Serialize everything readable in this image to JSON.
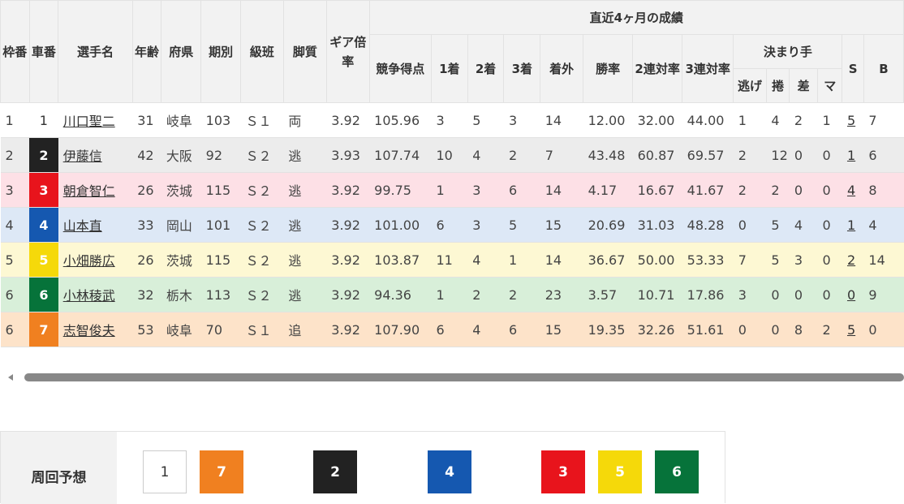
{
  "colors": {
    "car_1": "#ffffff",
    "car_2": "#222222",
    "car_3": "#e8141c",
    "car_4": "#1558b0",
    "car_5": "#f5d90a",
    "car_6": "#06733a",
    "car_7": "#f08020"
  },
  "table": {
    "headers": {
      "waku": "枠番",
      "sha": "車番",
      "name": "選手名",
      "age": "年齢",
      "pref": "府県",
      "term": "期別",
      "class": "級班",
      "style": "脚質",
      "gear": "ギア倍率",
      "recent": "直近4ヶ月の成績",
      "score": "競争得点",
      "first": "1着",
      "second": "2着",
      "third": "3着",
      "out": "着外",
      "win_rate": "勝率",
      "top2": "2連対率",
      "top3": "3連対率",
      "kimarite": "決まり手",
      "nige": "逃げ",
      "makuri": "捲",
      "sashi": "差",
      "ma": "マ",
      "s": "S",
      "b": "B"
    },
    "rows": [
      {
        "waku": "1",
        "car": "1",
        "name": "川口聖二",
        "age": "31",
        "pref": "岐阜",
        "term": "103",
        "class": "Ｓ１",
        "style": "両",
        "gear": "3.92",
        "score": "105.96",
        "first": "3",
        "second": "5",
        "third": "3",
        "out": "14",
        "win_rate": "12.00",
        "top2": "32.00",
        "top3": "44.00",
        "nige": "1",
        "makuri": "4",
        "sashi": "2",
        "ma": "1",
        "s": "5",
        "b": "7"
      },
      {
        "waku": "2",
        "car": "2",
        "name": "伊藤信",
        "age": "42",
        "pref": "大阪",
        "term": "92",
        "class": "Ｓ２",
        "style": "逃",
        "gear": "3.93",
        "score": "107.74",
        "first": "10",
        "second": "4",
        "third": "2",
        "out": "7",
        "win_rate": "43.48",
        "top2": "60.87",
        "top3": "69.57",
        "nige": "2",
        "makuri": "12",
        "sashi": "0",
        "ma": "0",
        "s": "1",
        "b": "6"
      },
      {
        "waku": "3",
        "car": "3",
        "name": "朝倉智仁",
        "age": "26",
        "pref": "茨城",
        "term": "115",
        "class": "Ｓ２",
        "style": "逃",
        "gear": "3.92",
        "score": "99.75",
        "first": "1",
        "second": "3",
        "third": "6",
        "out": "14",
        "win_rate": "4.17",
        "top2": "16.67",
        "top3": "41.67",
        "nige": "2",
        "makuri": "2",
        "sashi": "0",
        "ma": "0",
        "s": "4",
        "b": "8"
      },
      {
        "waku": "4",
        "car": "4",
        "name": "山本直",
        "age": "33",
        "pref": "岡山",
        "term": "101",
        "class": "Ｓ２",
        "style": "逃",
        "gear": "3.92",
        "score": "101.00",
        "first": "6",
        "second": "3",
        "third": "5",
        "out": "15",
        "win_rate": "20.69",
        "top2": "31.03",
        "top3": "48.28",
        "nige": "0",
        "makuri": "5",
        "sashi": "4",
        "ma": "0",
        "s": "1",
        "b": "4"
      },
      {
        "waku": "5",
        "car": "5",
        "name": "小畑勝広",
        "age": "26",
        "pref": "茨城",
        "term": "115",
        "class": "Ｓ２",
        "style": "逃",
        "gear": "3.92",
        "score": "103.87",
        "first": "11",
        "second": "4",
        "third": "1",
        "out": "14",
        "win_rate": "36.67",
        "top2": "50.00",
        "top3": "53.33",
        "nige": "7",
        "makuri": "5",
        "sashi": "3",
        "ma": "0",
        "s": "2",
        "b": "14"
      },
      {
        "waku": "6",
        "car": "6",
        "name": "小林稜武",
        "age": "32",
        "pref": "栃木",
        "term": "113",
        "class": "Ｓ２",
        "style": "逃",
        "gear": "3.92",
        "score": "94.36",
        "first": "1",
        "second": "2",
        "third": "2",
        "out": "23",
        "win_rate": "3.57",
        "top2": "10.71",
        "top3": "17.86",
        "nige": "3",
        "makuri": "0",
        "sashi": "0",
        "ma": "0",
        "s": "0",
        "b": "9"
      },
      {
        "waku": "6",
        "car": "7",
        "name": "志智俊夫",
        "age": "53",
        "pref": "岐阜",
        "term": "70",
        "class": "Ｓ１",
        "style": "追",
        "gear": "3.92",
        "score": "107.90",
        "first": "6",
        "second": "4",
        "third": "6",
        "out": "15",
        "win_rate": "19.35",
        "top2": "32.26",
        "top3": "51.61",
        "nige": "0",
        "makuri": "0",
        "sashi": "8",
        "ma": "2",
        "s": "5",
        "b": "0"
      }
    ]
  },
  "prediction": {
    "label": "周回予想",
    "boxes": [
      "1",
      "7",
      "2",
      "4",
      "3",
      "5",
      "6"
    ]
  }
}
